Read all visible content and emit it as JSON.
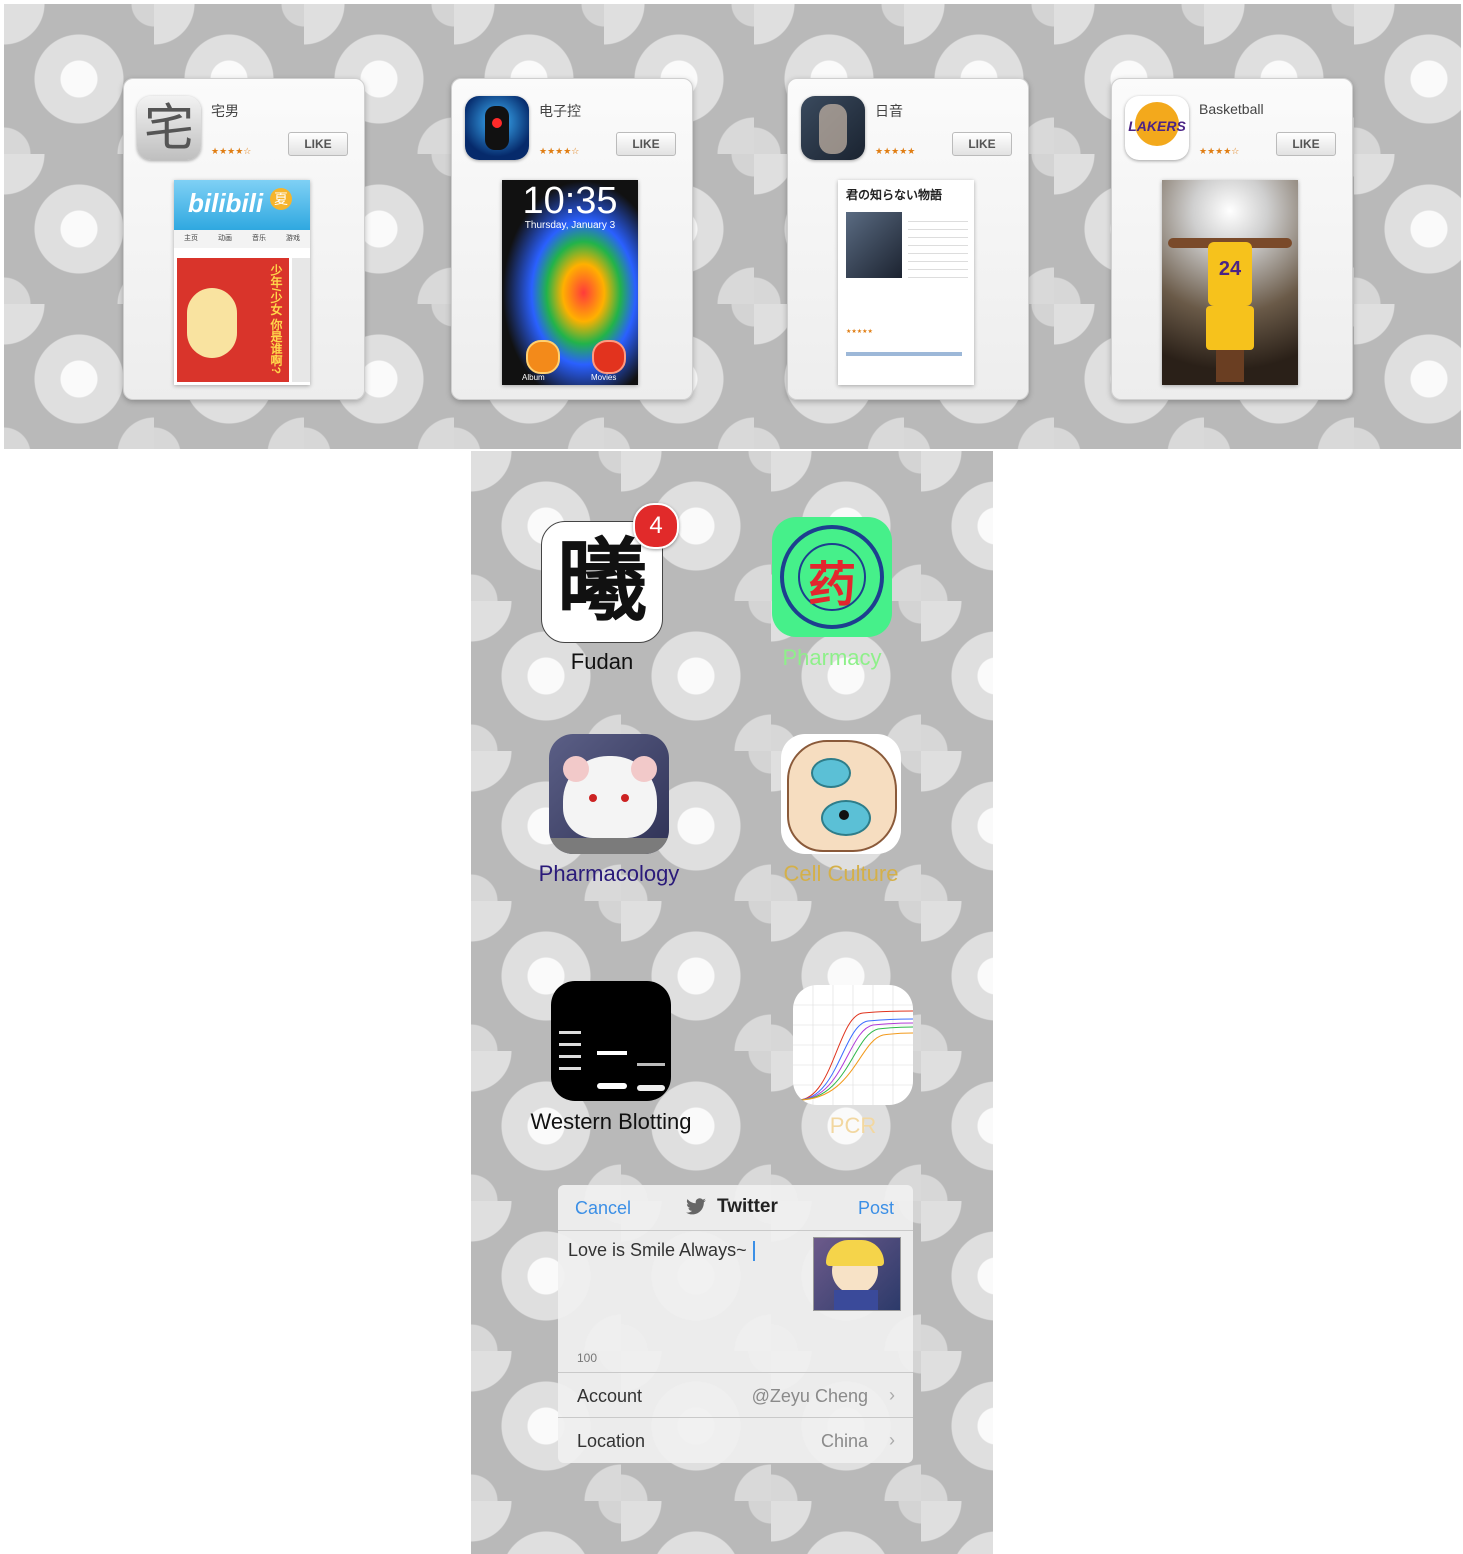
{
  "app_cards": [
    {
      "title": "宅男",
      "icon_glyph": "宅",
      "rating": "★★★★☆",
      "button": "LIKE"
    },
    {
      "title": "电子控",
      "rating": "★★★★☆",
      "button": "LIKE",
      "screenshot_time": "10:35",
      "screenshot_date": "Thursday, January 3",
      "dock_left": "Album",
      "dock_right": "Movies"
    },
    {
      "title": "日音",
      "rating": "★★★★★",
      "button": "LIKE",
      "screenshot_heading": "君の知らない物語"
    },
    {
      "title": "Basketball",
      "rating": "★★★★☆",
      "button": "LIKE",
      "icon_text": "LAKERS"
    }
  ],
  "bilibili": {
    "logo": "bilibili",
    "summer": "夏",
    "nav": [
      "主页",
      "动画",
      "音乐",
      "游戏"
    ],
    "poster": "少年/少女 你是谁啊?"
  },
  "jersey_number": "24",
  "home_icons": [
    {
      "label": "Fudan",
      "badge": "4",
      "glyph": "曦",
      "label_color": "#111111"
    },
    {
      "label": "Pharmacy",
      "glyph": "药",
      "label_color": "#8ef08a"
    },
    {
      "label": "Pharmacology",
      "label_color": "#2a1a7a"
    },
    {
      "label": "Cell Culture",
      "label_color": "#d4b04a"
    },
    {
      "label": "Western Blotting",
      "label_color": "#111111"
    },
    {
      "label": "PCR",
      "label_color": "#f2d7a0"
    }
  ],
  "tweet": {
    "cancel": "Cancel",
    "title": "Twitter",
    "post": "Post",
    "text": "Love is Smile Always~",
    "count": "100",
    "account_label": "Account",
    "account_value": "@Zeyu Cheng",
    "location_label": "Location",
    "location_value": "China",
    "chevron": "›"
  },
  "colors": {
    "accent": "#3b8fe6",
    "badge": "#e12a2a",
    "star": "#e07d12"
  }
}
